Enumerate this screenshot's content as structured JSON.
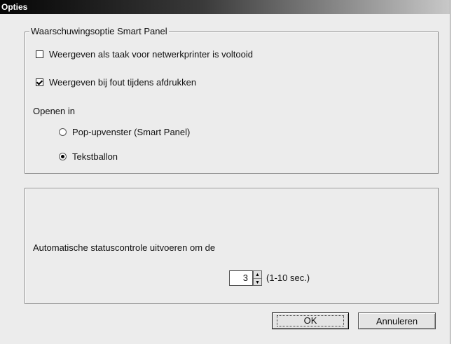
{
  "window": {
    "title": "Opties"
  },
  "notify_group": {
    "legend": "Waarschuwingsoptie Smart Panel",
    "check1": {
      "label": "Weergeven als taak voor netwerkprinter is voltooid",
      "checked": false
    },
    "check2": {
      "label": "Weergeven bij fout tijdens afdrukken",
      "checked": true
    },
    "open_in_label": "Openen in",
    "radio1": {
      "label": "Pop-upvenster (Smart Panel)",
      "selected": false
    },
    "radio2": {
      "label": "Tekstballon",
      "selected": true
    }
  },
  "status_group": {
    "label": "Automatische statuscontrole uitvoeren om de",
    "interval_value": "3",
    "range_text": "(1-10 sec.)",
    "spin_up": "▲",
    "spin_down": "▼"
  },
  "buttons": {
    "ok": "OK",
    "cancel": "Annuleren"
  }
}
